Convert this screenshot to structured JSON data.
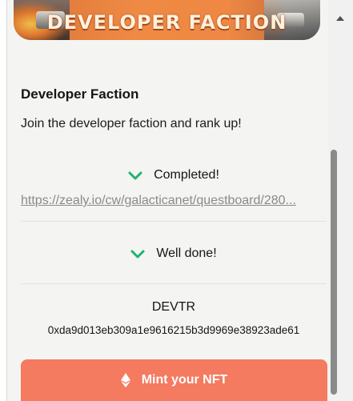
{
  "banner": {
    "title": "DEVELOPER FACTION"
  },
  "quest": {
    "title": "Developer Faction",
    "description": "Join the developer faction and rank up!"
  },
  "statuses": [
    {
      "label": "Completed!",
      "icon": "checkmark-icon"
    },
    {
      "label": "Well done!",
      "icon": "checkmark-icon"
    }
  ],
  "link": {
    "text": "https://zealy.io/cw/galacticanet/questboard/280..."
  },
  "token": {
    "name": "DEVTR",
    "address": "0xda9d013eb309a1e9616215b3d9969e38923ade61"
  },
  "mint": {
    "label": "Mint your NFT",
    "icon": "ethereum-icon"
  },
  "colors": {
    "accent": "#f47a60",
    "check": "#1db36f",
    "panel": "#f4f4f2"
  }
}
